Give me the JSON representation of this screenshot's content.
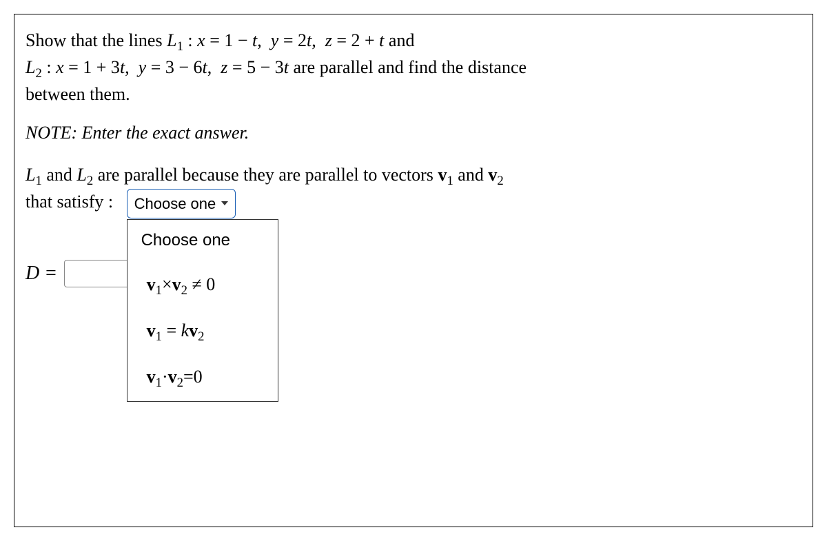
{
  "problem": {
    "line1": "Show that the lines L₁ : x = 1 − t,  y = 2t,  z = 2 + t and",
    "line2": "L₂ : x = 1 + 3t,  y = 3 − 6t,  z = 5 − 3t are parallel and find the distance",
    "line3": "between them."
  },
  "note": "NOTE: Enter the exact answer.",
  "explanation": {
    "line1": "L₁ and L₂ are parallel because they are parallel to vectors v₁ and v₂",
    "line2_prefix": "that satisfy : "
  },
  "dropdown": {
    "selected": "Choose one",
    "options_head": "Choose one",
    "option1": "v₁×v₂ ≠ 0",
    "option2": "v₁ = kv₂",
    "option3": "v₁·v₂=0"
  },
  "d_label": "D =",
  "d_value": ""
}
